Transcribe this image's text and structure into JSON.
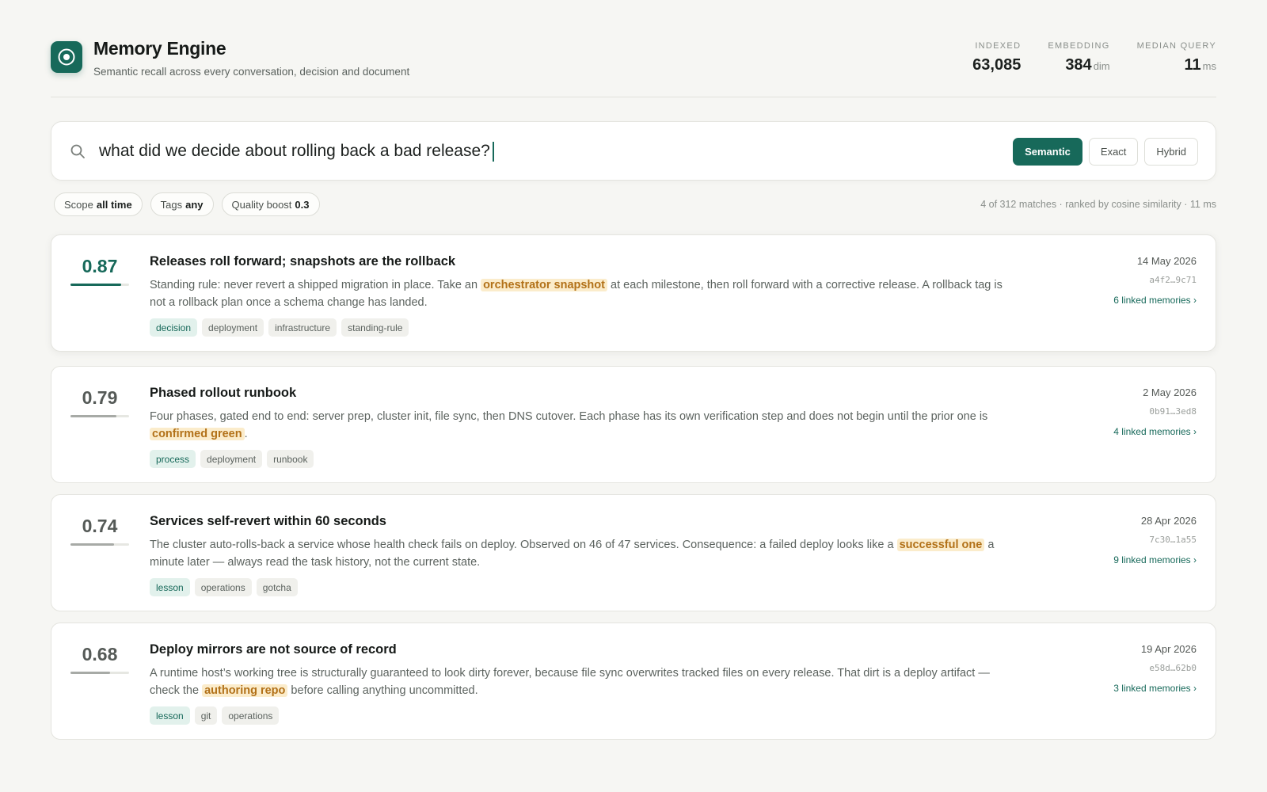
{
  "app": {
    "title": "Memory Engine",
    "subtitle": "Semantic recall across every conversation, decision and document",
    "logo_icon": "target-icon",
    "accent": "#17695a"
  },
  "stats": [
    {
      "label": "INDEXED",
      "value": "63,085",
      "unit": ""
    },
    {
      "label": "EMBEDDING",
      "value": "384",
      "unit": "dim"
    },
    {
      "label": "MEDIAN QUERY",
      "value": "11",
      "unit": "ms"
    }
  ],
  "search": {
    "icon": "search-icon",
    "query": "what did we decide about rolling back a bad release?",
    "modes": [
      "Semantic",
      "Exact",
      "Hybrid"
    ],
    "active_mode": "Semantic"
  },
  "filters": [
    {
      "label": "Scope",
      "value": "all time"
    },
    {
      "label": "Tags",
      "value": "any"
    },
    {
      "label": "Quality boost",
      "value": "0.3"
    }
  ],
  "results_meta": "4 of 312 matches · ranked by cosine similarity · 11 ms",
  "results": [
    {
      "score": "0.87",
      "score_value": 0.87,
      "title": "Releases roll forward; snapshots are the rollback",
      "body_before": "Standing rule: never revert a shipped migration in place. Take an ",
      "body_highlight": "orchestrator snapshot",
      "body_after": " at each milestone, then roll forward with a corrective release. A rollback tag is not a rollback plan once a schema change has landed.",
      "tags": [
        "decision",
        "deployment",
        "infrastructure",
        "standing-rule"
      ],
      "date": "14 May 2026",
      "id": "a4f2…9c71",
      "linked": "6 linked memories ›"
    },
    {
      "score": "0.79",
      "score_value": 0.79,
      "title": "Phased rollout runbook",
      "body_before": "Four phases, gated end to end: server prep, cluster init, file sync, then DNS cutover. Each phase has its own verification step and does not begin until the prior one is ",
      "body_highlight": "confirmed green",
      "body_after": ".",
      "tags": [
        "process",
        "deployment",
        "runbook"
      ],
      "date": "2 May 2026",
      "id": "0b91…3ed8",
      "linked": "4 linked memories ›"
    },
    {
      "score": "0.74",
      "score_value": 0.74,
      "title": "Services self-revert within 60 seconds",
      "body_before": "The cluster auto-rolls-back a service whose health check fails on deploy. Observed on 46 of 47 services. Consequence: a failed deploy looks like a ",
      "body_highlight": "successful one",
      "body_after": " a minute later — always read the task history, not the current state.",
      "tags": [
        "lesson",
        "operations",
        "gotcha"
      ],
      "date": "28 Apr 2026",
      "id": "7c30…1a55",
      "linked": "9 linked memories ›"
    },
    {
      "score": "0.68",
      "score_value": 0.68,
      "title": "Deploy mirrors are not source of record",
      "body_before": "A runtime host’s working tree is structurally guaranteed to look dirty forever, because file sync overwrites tracked files on every release. That dirt is a deploy artifact — check the ",
      "body_highlight": "authoring repo",
      "body_after": " before calling anything uncommitted.",
      "tags": [
        "lesson",
        "git",
        "operations"
      ],
      "date": "19 Apr 2026",
      "id": "e58d…62b0",
      "linked": "3 linked memories ›"
    }
  ]
}
